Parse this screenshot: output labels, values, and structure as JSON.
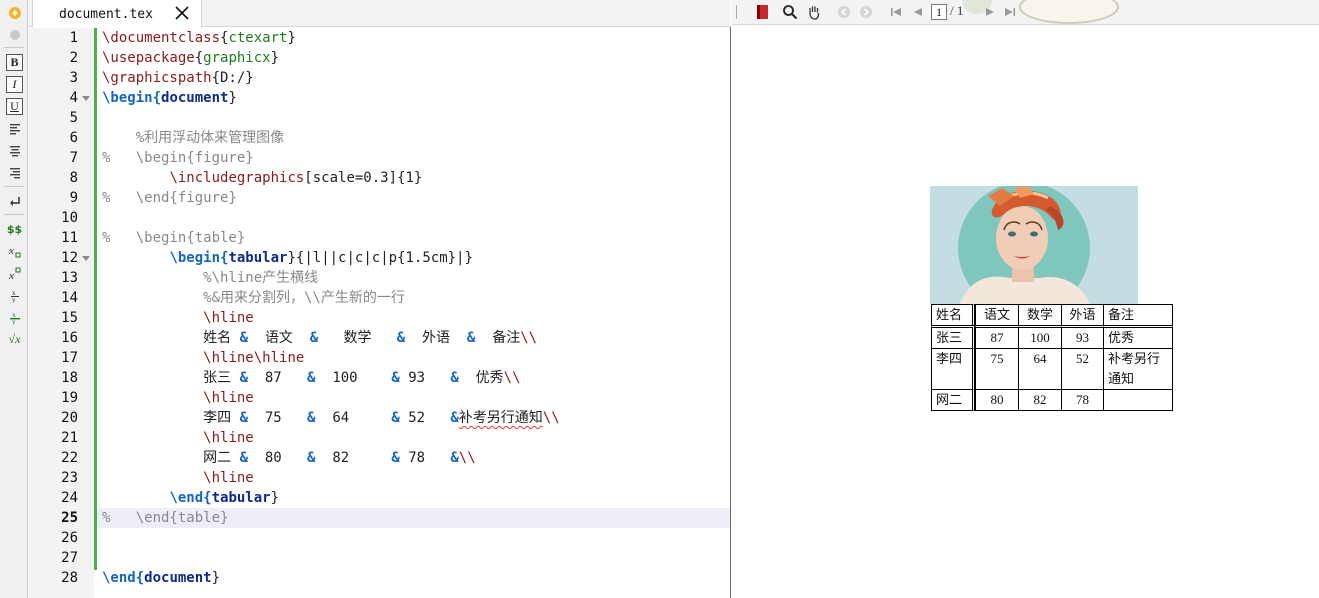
{
  "editor": {
    "tab": {
      "title": "document.tex"
    },
    "line_numbers": [
      "1",
      "2",
      "3",
      "4",
      "5",
      "6",
      "7",
      "8",
      "9",
      "10",
      "11",
      "12",
      "13",
      "14",
      "15",
      "16",
      "17",
      "18",
      "19",
      "20",
      "21",
      "22",
      "23",
      "24",
      "25",
      "26",
      "27",
      "28"
    ],
    "current_line": "25",
    "lines": [
      [
        "\\documentclass",
        "{",
        "ctexart",
        "}"
      ],
      [
        "\\usepackage",
        "{",
        "graphicx",
        "}"
      ],
      [
        "\\graphicspath",
        "{D:/}"
      ],
      [
        "\\begin",
        "{",
        "document",
        "}"
      ],
      [],
      [
        "    %利用浮动体来管理图像"
      ],
      [
        "%   \\begin{figure}"
      ],
      [
        "        ",
        "\\includegraphics",
        "[scale=0.3]{1}"
      ],
      [
        "%   \\end{figure}"
      ],
      [],
      [
        "%   \\begin{table}"
      ],
      [
        "        ",
        "\\begin",
        "{",
        "tabular",
        "}",
        "{|l||c|c|c|p{1.5cm}|}"
      ],
      [
        "            %\\hline产生横线"
      ],
      [
        "            %&用来分割列，\\\\产生新的一行"
      ],
      [
        "            ",
        "\\hline"
      ],
      [
        "            姓名 ",
        "&",
        "  语文  ",
        "&",
        "   数学   ",
        "&",
        "  外语  ",
        "&",
        "  备注",
        "\\\\"
      ],
      [
        "            ",
        "\\hline\\hline"
      ],
      [
        "            张三 ",
        "&",
        "  87   ",
        "&",
        "  100    ",
        "&",
        " 93   ",
        "&",
        "  优秀",
        "\\\\"
      ],
      [
        "            ",
        "\\hline"
      ],
      [
        "            李四 ",
        "&",
        "  75   ",
        "&",
        "  64     ",
        "&",
        " 52   ",
        "&",
        "补考另行通知",
        "\\\\"
      ],
      [
        "            ",
        "\\hline"
      ],
      [
        "            网二 ",
        "&",
        "  80   ",
        "&",
        "  82     ",
        "&",
        " 78   ",
        "&",
        "\\\\"
      ],
      [
        "            ",
        "\\hline"
      ],
      [
        "        ",
        "\\end",
        "{",
        "tabular",
        "}"
      ],
      [
        "%   \\end{table}"
      ],
      [],
      [],
      [
        "\\end",
        "{",
        "document",
        "}"
      ]
    ]
  },
  "left_toolbar": {
    "bold": "B",
    "italic": "I",
    "underline": "U",
    "math": "$$",
    "sqrt": "√x"
  },
  "preview": {
    "page_current": "1",
    "page_total": "/ 1",
    "table": {
      "header": [
        "姓名",
        "语文",
        "数学",
        "外语",
        "备注"
      ],
      "rows": [
        [
          "张三",
          "87",
          "100",
          "93",
          "优秀"
        ],
        [
          "李四",
          "75",
          "64",
          "52",
          "补考另行通知"
        ],
        [
          "网二",
          "80",
          "82",
          "78",
          ""
        ]
      ]
    }
  },
  "colors": {
    "command": "#8b1a1a",
    "keyword": "#1565c0",
    "comment": "#888888",
    "change_bar": "#4caf50",
    "image_background": "#c4dde3"
  }
}
